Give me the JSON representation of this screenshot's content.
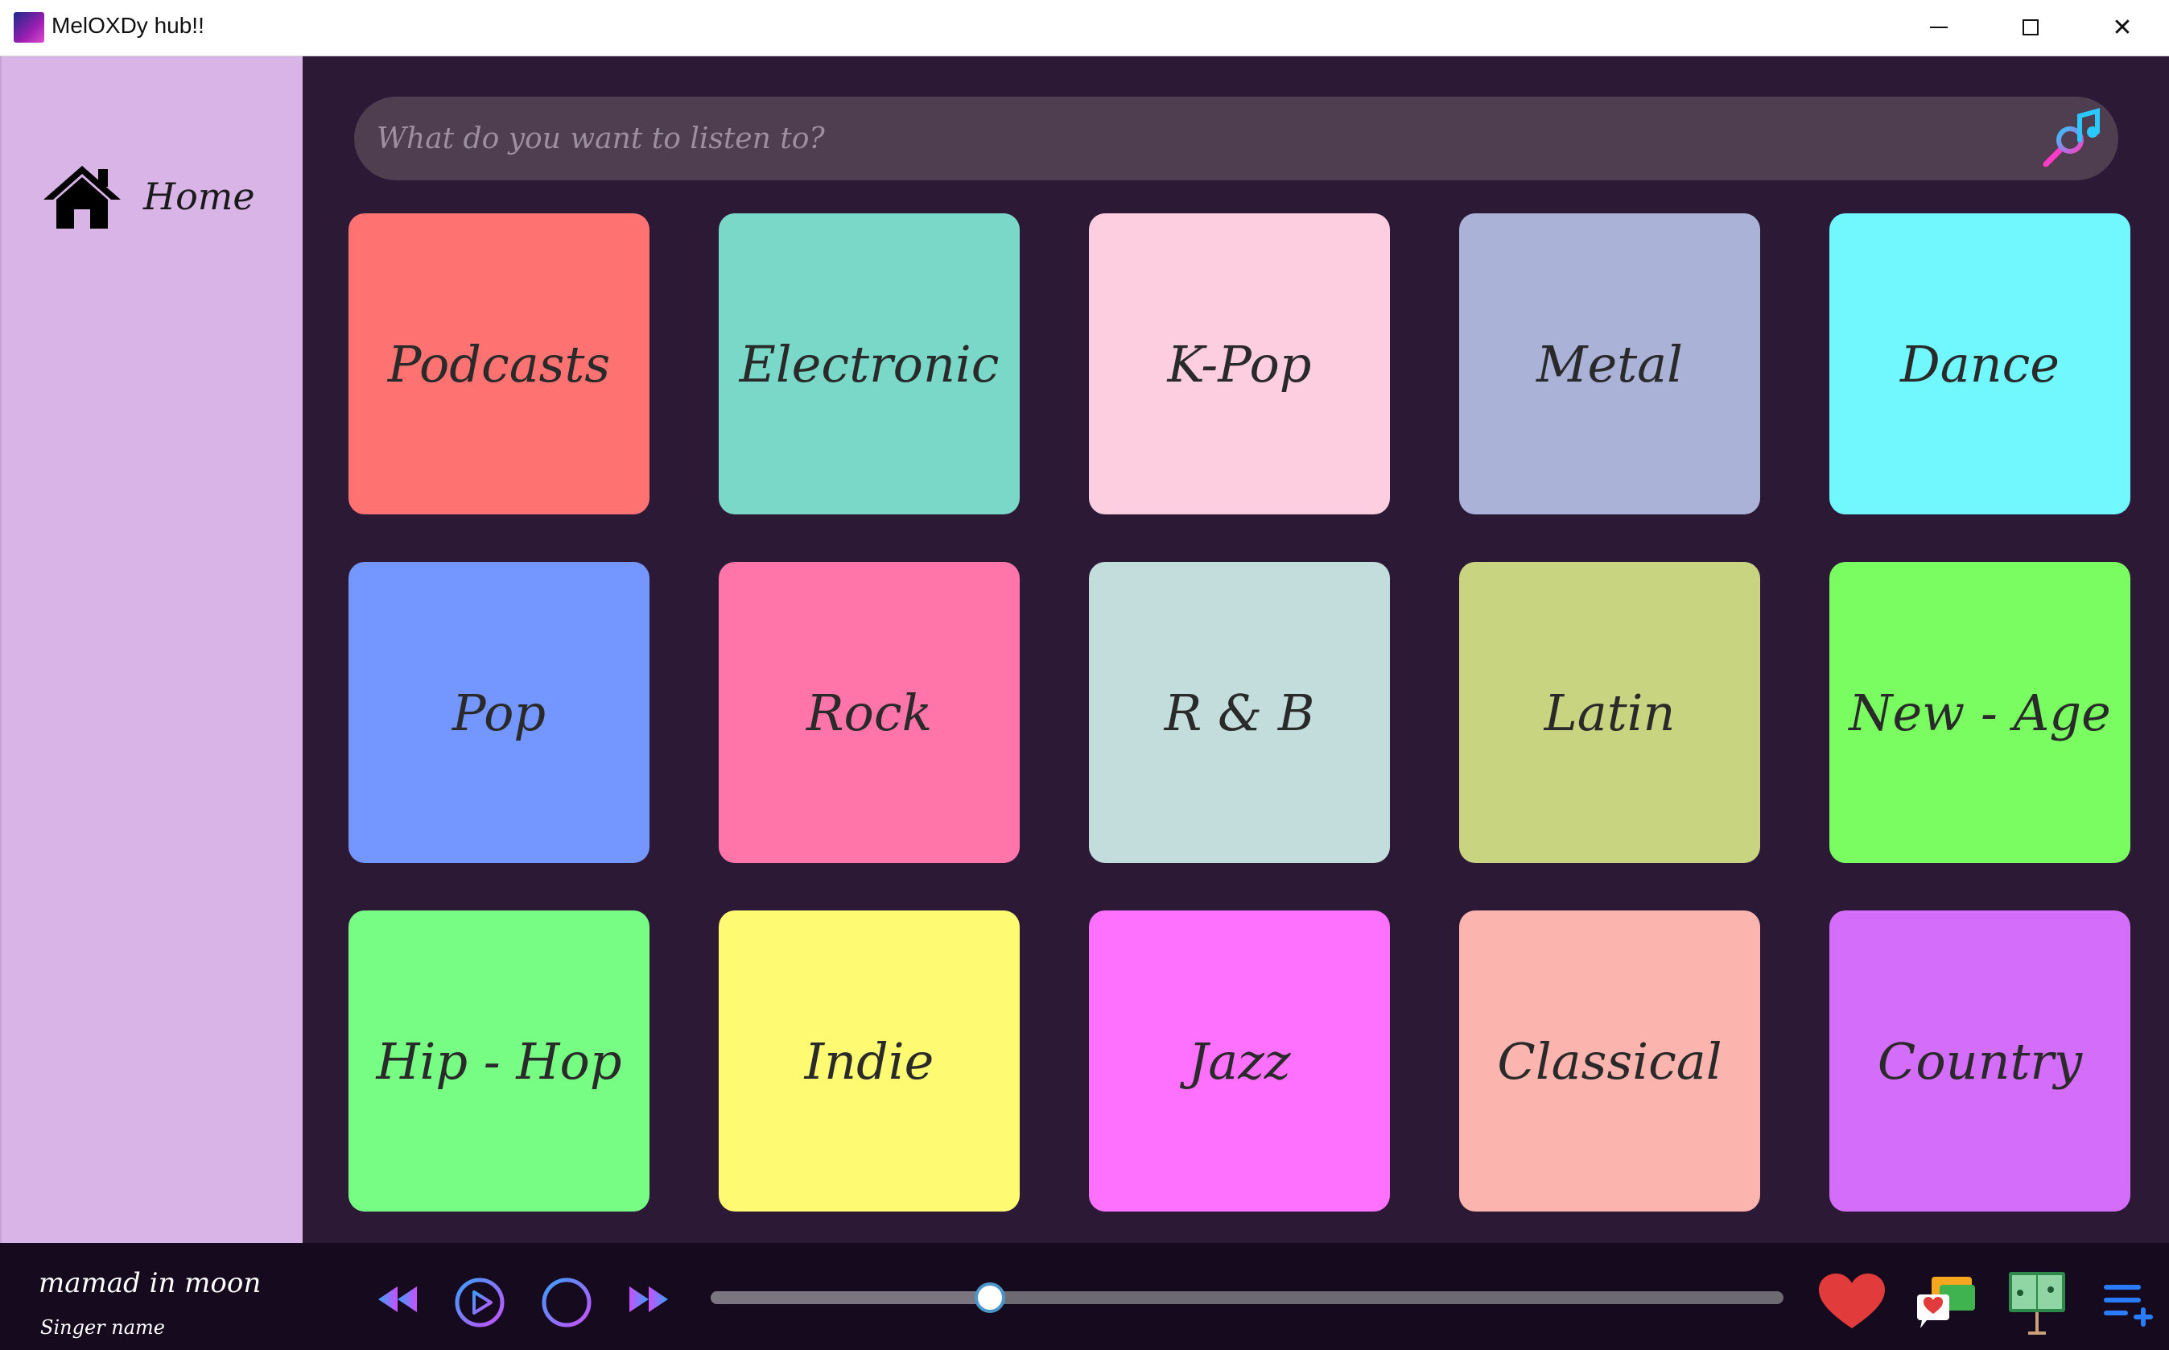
{
  "window": {
    "title": "MelOXDy hub!!",
    "minimize_glyph": "–",
    "close_glyph": "✕"
  },
  "sidebar": {
    "items": [
      {
        "label": "Home",
        "icon": "home-icon"
      }
    ]
  },
  "search": {
    "placeholder": "What do you want to listen to?",
    "icon": "music-search-icon"
  },
  "genres": [
    {
      "label": "Podcasts",
      "color": "#ff7272"
    },
    {
      "label": "Electronic",
      "color": "#79d8c7"
    },
    {
      "label": "K-Pop",
      "color": "#fdcde0"
    },
    {
      "label": "Metal",
      "color": "#aab2d7"
    },
    {
      "label": "Dance",
      "color": "#71f8ff"
    },
    {
      "label": "Pop",
      "color": "#7396ff"
    },
    {
      "label": "Rock",
      "color": "#ff75a9"
    },
    {
      "label": "R & B",
      "color": "#c3dddd"
    },
    {
      "label": "Latin",
      "color": "#c8d47f"
    },
    {
      "label": "New - Age",
      "color": "#79fd60"
    },
    {
      "label": "Hip - Hop",
      "color": "#77fd84"
    },
    {
      "label": "Indie",
      "color": "#fefb72"
    },
    {
      "label": "Jazz",
      "color": "#fd71fe"
    },
    {
      "label": "Classical",
      "color": "#fcb4ae"
    },
    {
      "label": "Country",
      "color": "#d46dfa"
    }
  ],
  "player": {
    "song_title": "mamad in moon",
    "singer": "Singer name",
    "progress": 0.26,
    "accent_gradient": [
      "#3aa0ff",
      "#c850ff"
    ],
    "controls": [
      "rewind-icon",
      "play-icon",
      "pause-icon",
      "fast-forward-icon"
    ],
    "actions": [
      "heart-icon",
      "chat-icon",
      "lyrics-book-icon",
      "playlist-add-icon"
    ]
  }
}
